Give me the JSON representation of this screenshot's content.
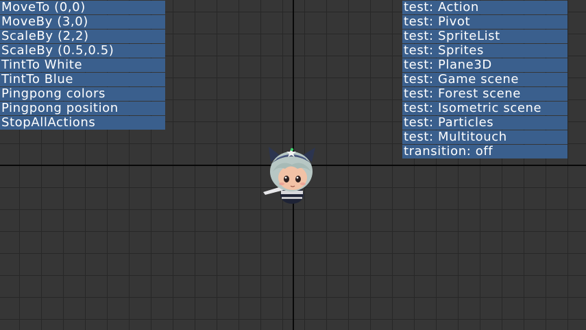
{
  "left_menu": {
    "items": [
      "MoveTo (0,0)",
      "MoveBy (3,0)",
      "ScaleBy (2,2)",
      "ScaleBy (0.5,0.5)",
      "TintTo White",
      "TintTo Blue",
      "Pingpong colors",
      "Pingpong position",
      "StopAllActions"
    ]
  },
  "right_menu": {
    "items": [
      "test: Action",
      "test: Pivot",
      "test: SpriteList",
      "test: Sprites",
      "test: Plane3D",
      "test: Game scene",
      "test: Forest scene",
      "test: Isometric scene",
      "test: Particles",
      "test: Multitouch",
      "transition: off"
    ]
  },
  "colors": {
    "button_bg": "#3a5f8d",
    "button_text": "#ffffff",
    "grid_bg": "#363636",
    "grid_line": "#272727",
    "axis": "#080808"
  },
  "sprite": {
    "icon": "chibi-character-sprite"
  }
}
